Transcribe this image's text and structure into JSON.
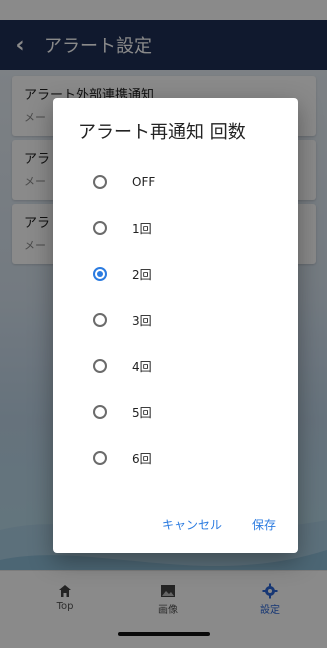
{
  "appbar": {
    "back_icon": "‹",
    "title": "アラート設定"
  },
  "background_cards": [
    {
      "title": "アラート外部連携通知",
      "sub": "メー"
    },
    {
      "title": "アラ",
      "sub": "メー"
    },
    {
      "title": "アラ",
      "sub": "メー"
    }
  ],
  "bottom_nav": {
    "items": [
      {
        "label": "Top",
        "icon": "home-icon"
      },
      {
        "label": "画像",
        "icon": "image-icon"
      },
      {
        "label": "設定",
        "icon": "gear-icon"
      }
    ],
    "active_index": 2,
    "accent_color": "#2b66d6"
  },
  "dialog": {
    "title": "アラート再通知 回数",
    "options": [
      {
        "label": "OFF"
      },
      {
        "label": "1回"
      },
      {
        "label": "2回"
      },
      {
        "label": "3回"
      },
      {
        "label": "4回"
      },
      {
        "label": "5回"
      },
      {
        "label": "6回"
      }
    ],
    "selected_index": 2,
    "cancel_label": "キャンセル",
    "save_label": "保存",
    "accent_color": "#2b7be0"
  }
}
